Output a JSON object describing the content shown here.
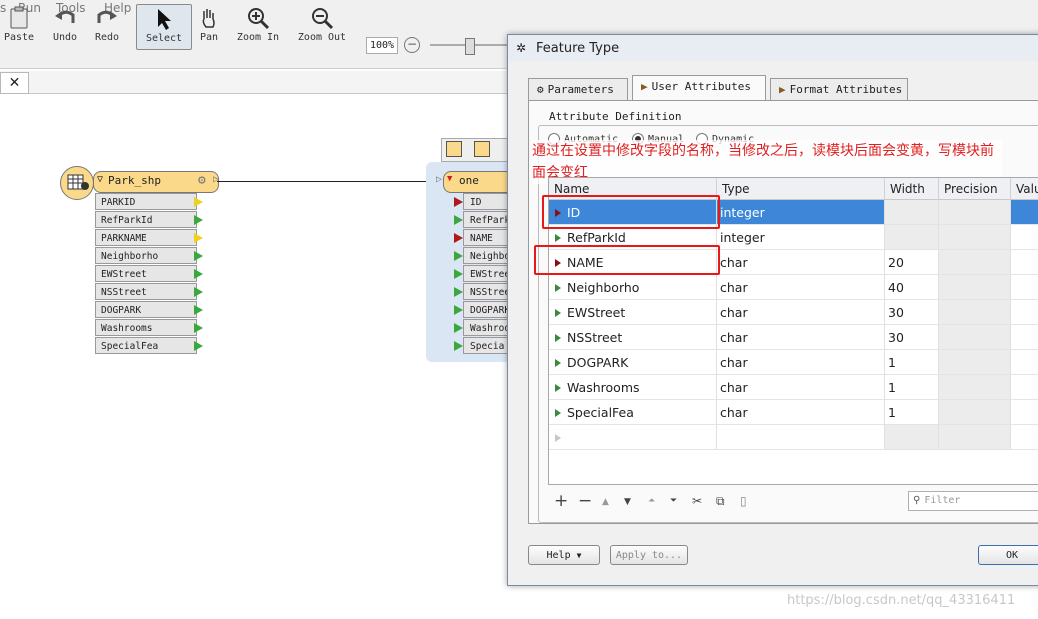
{
  "menu": [
    "s",
    "Run",
    "Tools",
    "Help"
  ],
  "toolbar": {
    "paste": "Paste",
    "undo": "Undo",
    "redo": "Redo",
    "select": "Select",
    "pan": "Pan",
    "zoom_in": "Zoom In",
    "zoom_out": "Zoom Out",
    "zoom_level": "100%"
  },
  "canvas": {
    "source_node": {
      "name": "Park_shp",
      "attributes": [
        "PARKID",
        "RefParkId",
        "PARKNAME",
        "Neighborho",
        "EWStreet",
        "NSStreet",
        "DOGPARK",
        "Washrooms",
        "SpecialFea"
      ]
    },
    "dest_node": {
      "name": "one",
      "attributes": [
        "ID",
        "RefPark",
        "NAME",
        "Neighbo",
        "EWStree",
        "NSStree",
        "DOGPARK",
        "Washroo",
        "Specia"
      ]
    }
  },
  "dialog": {
    "title": "Feature Type",
    "tabs": [
      "Parameters",
      "User Attributes",
      "Format Attributes"
    ],
    "group_title": "Attribute Definition",
    "modes": [
      "Automatic",
      "Manual",
      "Dynamic"
    ],
    "selected_mode": "Manual",
    "annotation": "通过在设置中修改字段的名称，当修改之后，读模块后面会变黄，写模块前面会变红",
    "columns": [
      "Name",
      "Type",
      "Width",
      "Precision",
      "Valu"
    ],
    "rows": [
      {
        "name": "ID",
        "type": "integer",
        "width": ""
      },
      {
        "name": "RefParkId",
        "type": "integer",
        "width": ""
      },
      {
        "name": "NAME",
        "type": "char",
        "width": "20"
      },
      {
        "name": "Neighborho",
        "type": "char",
        "width": "40"
      },
      {
        "name": "EWStreet",
        "type": "char",
        "width": "30"
      },
      {
        "name": "NSStreet",
        "type": "char",
        "width": "30"
      },
      {
        "name": "DOGPARK",
        "type": "char",
        "width": "1"
      },
      {
        "name": "Washrooms",
        "type": "char",
        "width": "1"
      },
      {
        "name": "SpecialFea",
        "type": "char",
        "width": "1"
      }
    ],
    "filter_placeholder": "Filter",
    "help": "Help",
    "apply_to": "Apply to...",
    "ok": "OK"
  },
  "watermark": "https://blog.csdn.net/qq_43316411"
}
